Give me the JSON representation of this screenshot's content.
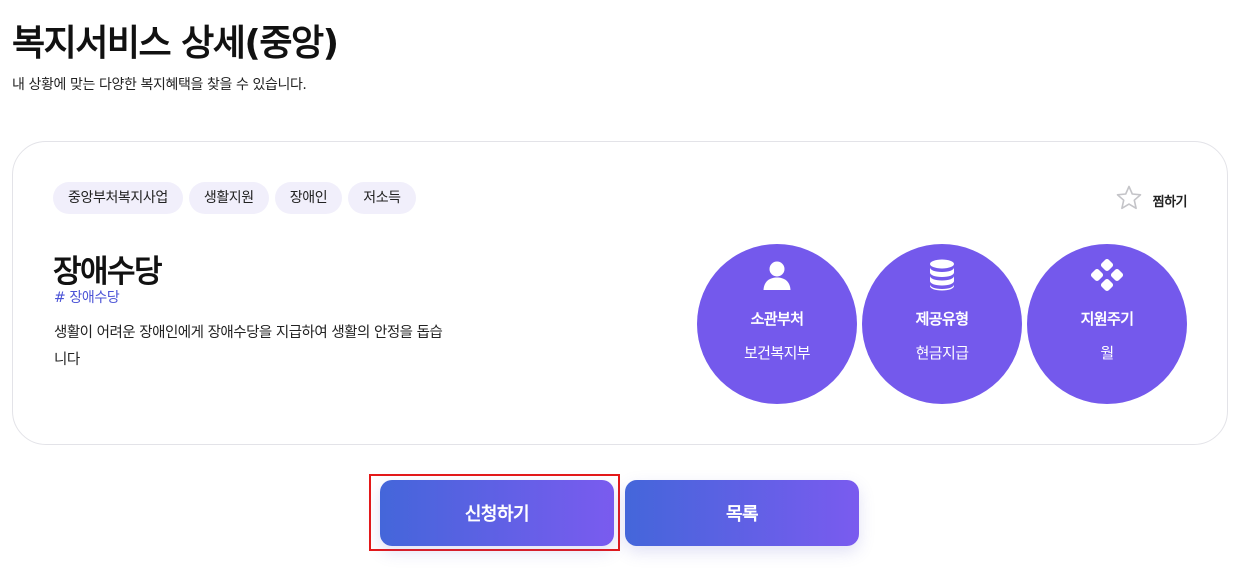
{
  "header": {
    "title": "복지서비스 상세(중앙)",
    "subtitle": "내 상황에 맞는 다양한 복지혜택을 찾을 수 있습니다."
  },
  "card": {
    "tags": [
      "중앙부처복지사업",
      "생활지원",
      "장애인",
      "저소득"
    ],
    "favorite_label": "찜하기",
    "service_name": "장애수당",
    "hashtag": "# 장애수당",
    "description": "생활이 어려운 장애인에게 장애수당을 지급하여 생활의 안정을 돕습니다",
    "info": [
      {
        "icon": "person-icon",
        "label": "소관부처",
        "value": "보건복지부"
      },
      {
        "icon": "database-icon",
        "label": "제공유형",
        "value": "현금지급"
      },
      {
        "icon": "cycle-icon",
        "label": "지원주기",
        "value": "월"
      }
    ]
  },
  "actions": {
    "apply_label": "신청하기",
    "list_label": "목록"
  },
  "colors": {
    "accent": "#7459ec",
    "tag_bg": "#f1effb",
    "hashtag": "#4b53d6",
    "button_gradient_start": "#4466da",
    "button_gradient_end": "#7a5bef",
    "highlight": "#e41919"
  }
}
